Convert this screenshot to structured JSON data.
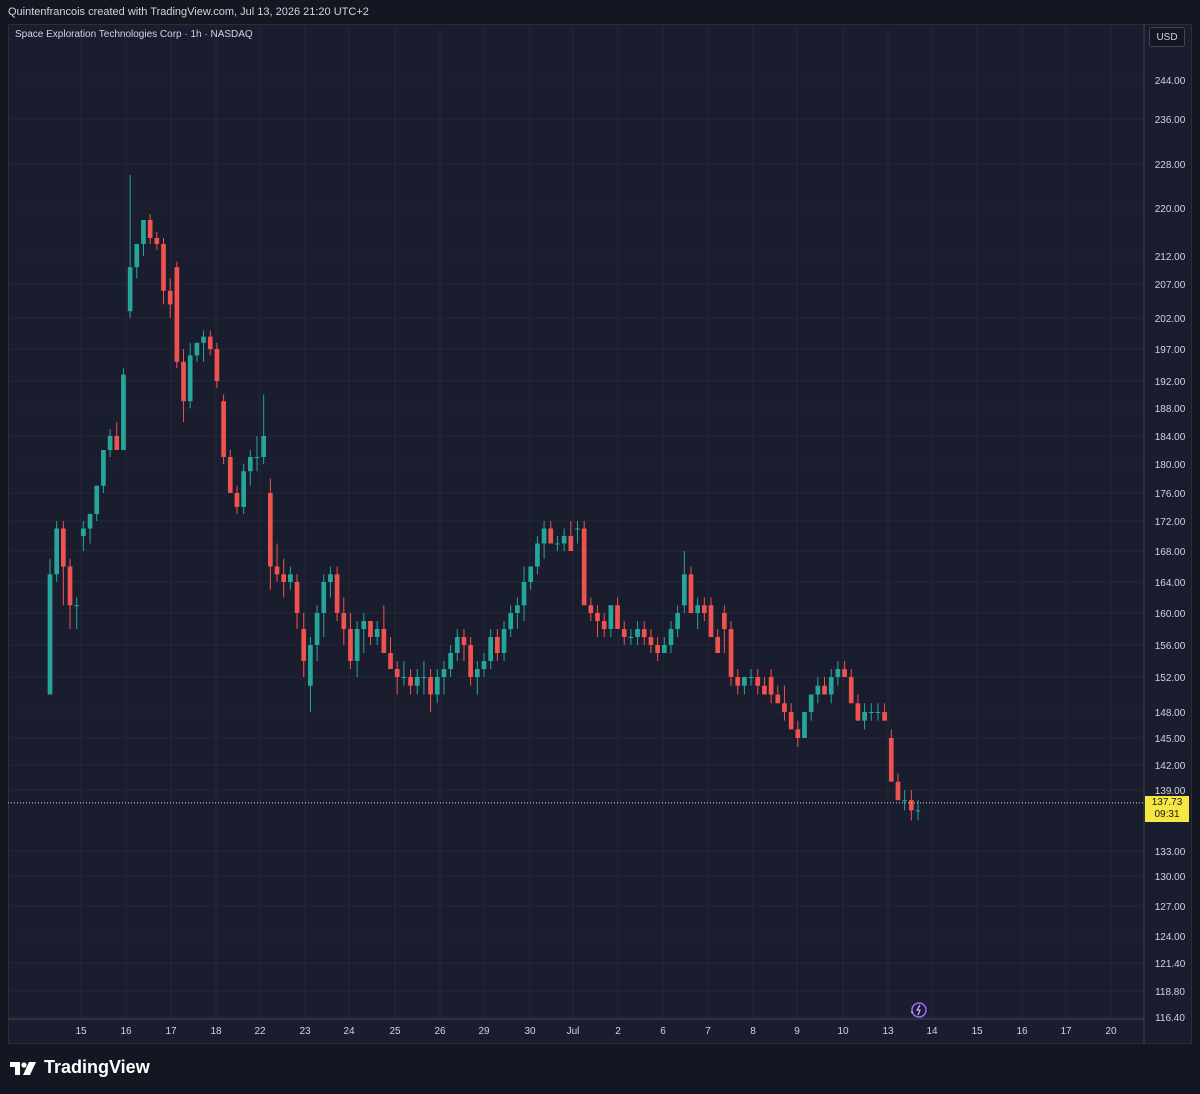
{
  "header": {
    "attribution": "Quintenfrancois created with TradingView.com, Jul 13, 2026 21:20 UTC+2"
  },
  "brand": {
    "name": "TradingView",
    "logo_icon": "tradingview-logo-icon"
  },
  "colors": {
    "up": "#26a69a",
    "down": "#ef5350",
    "background": "#1a1d2e",
    "grid": "#242838",
    "last_price_bg": "#f5e642"
  },
  "chart_data": {
    "type": "candlestick",
    "title": "Space Exploration Technologies Corp · 1h · NASDAQ",
    "currency": "USD",
    "last_price": "137.73",
    "countdown": "09:31",
    "y_ticks": [
      "244.00",
      "236.00",
      "228.00",
      "220.00",
      "212.00",
      "207.00",
      "202.00",
      "197.00",
      "192.00",
      "188.00",
      "184.00",
      "180.00",
      "176.00",
      "172.00",
      "168.00",
      "164.00",
      "160.00",
      "156.00",
      "152.00",
      "148.00",
      "145.00",
      "142.00",
      "139.00",
      "133.00",
      "130.00",
      "127.00",
      "124.00",
      "121.40",
      "118.80",
      "116.40"
    ],
    "x_ticks": [
      "15",
      "16",
      "17",
      "18",
      "22",
      "23",
      "24",
      "25",
      "26",
      "29",
      "30",
      "Jul",
      "2",
      "6",
      "7",
      "8",
      "9",
      "10",
      "13",
      "14",
      "15",
      "16",
      "17",
      "20"
    ],
    "candles": [
      [
        150,
        167,
        150,
        165
      ],
      [
        165,
        172,
        164,
        171
      ],
      [
        171,
        172,
        161,
        166
      ],
      [
        166,
        167,
        158,
        161
      ],
      [
        161,
        162,
        158,
        161
      ],
      [
        170,
        172,
        168,
        171
      ],
      [
        171,
        173,
        169,
        173
      ],
      [
        173,
        177,
        172,
        177
      ],
      [
        177,
        182,
        176,
        182
      ],
      [
        182,
        185,
        181,
        184
      ],
      [
        184,
        186,
        182,
        182
      ],
      [
        182,
        194,
        182,
        193
      ],
      [
        203,
        226,
        202,
        210
      ],
      [
        210,
        214,
        208,
        214
      ],
      [
        214,
        218,
        212,
        218
      ],
      [
        218,
        219,
        214,
        215
      ],
      [
        215,
        216,
        213,
        214
      ],
      [
        214,
        215,
        204,
        206
      ],
      [
        206,
        208,
        202,
        204
      ],
      [
        210,
        211,
        194,
        195
      ],
      [
        195,
        197,
        186,
        189
      ],
      [
        189,
        198,
        188,
        196
      ],
      [
        196,
        198,
        195,
        198
      ],
      [
        198,
        200,
        195,
        199
      ],
      [
        199,
        200,
        196,
        197
      ],
      [
        197,
        198,
        191,
        192
      ],
      [
        189,
        190,
        180,
        181
      ],
      [
        181,
        182,
        176,
        176
      ],
      [
        176,
        177,
        173,
        174
      ],
      [
        174,
        180,
        173,
        179
      ],
      [
        179,
        182,
        177,
        181
      ],
      [
        181,
        184,
        179,
        181
      ],
      [
        181,
        190,
        180,
        184
      ],
      [
        176,
        178,
        163,
        166
      ],
      [
        166,
        169,
        164,
        165
      ],
      [
        165,
        167,
        162,
        164
      ],
      [
        164,
        166,
        163,
        165
      ],
      [
        164,
        165,
        158,
        160
      ],
      [
        158,
        160,
        152,
        154
      ],
      [
        151,
        157,
        148,
        156
      ],
      [
        156,
        161,
        154,
        160
      ],
      [
        160,
        165,
        157,
        164
      ],
      [
        164,
        166,
        162,
        165
      ],
      [
        165,
        166,
        159,
        160
      ],
      [
        160,
        162,
        156,
        158
      ],
      [
        158,
        160,
        153,
        154
      ],
      [
        154,
        159,
        152,
        158
      ],
      [
        158,
        160,
        155,
        159
      ],
      [
        159,
        159,
        156,
        157
      ],
      [
        157,
        159,
        156,
        158
      ],
      [
        158,
        161,
        155,
        155
      ],
      [
        155,
        157,
        153,
        153
      ],
      [
        153,
        154,
        150,
        152
      ],
      [
        152,
        154,
        151,
        152
      ],
      [
        152,
        153,
        150,
        151
      ],
      [
        151,
        153,
        150,
        152
      ],
      [
        152,
        154,
        150,
        152
      ],
      [
        152,
        153,
        148,
        150
      ],
      [
        150,
        153,
        149,
        152
      ],
      [
        152,
        154,
        150,
        153
      ],
      [
        153,
        156,
        152,
        155
      ],
      [
        155,
        158,
        154,
        157
      ],
      [
        157,
        158,
        154,
        156
      ],
      [
        156,
        157,
        151,
        152
      ],
      [
        152,
        154,
        150,
        153
      ],
      [
        153,
        155,
        152,
        154
      ],
      [
        154,
        158,
        153,
        157
      ],
      [
        157,
        158,
        154,
        155
      ],
      [
        155,
        159,
        154,
        158
      ],
      [
        158,
        161,
        157,
        160
      ],
      [
        160,
        162,
        158,
        161
      ],
      [
        161,
        166,
        159,
        164
      ],
      [
        164,
        166,
        163,
        166
      ],
      [
        166,
        170,
        165,
        169
      ],
      [
        169,
        172,
        167,
        171
      ],
      [
        171,
        172,
        169,
        169
      ],
      [
        169,
        170,
        168,
        169
      ],
      [
        169,
        171,
        168,
        170
      ],
      [
        170,
        172,
        168,
        168
      ],
      [
        171,
        172,
        169,
        171
      ],
      [
        171,
        172,
        164,
        161
      ],
      [
        161,
        162,
        159,
        160
      ],
      [
        160,
        161,
        157,
        159
      ],
      [
        159,
        160,
        157,
        158
      ],
      [
        158,
        161,
        157,
        161
      ],
      [
        161,
        162,
        158,
        158
      ],
      [
        158,
        159,
        156,
        157
      ],
      [
        157,
        158,
        156,
        157
      ],
      [
        157,
        159,
        156,
        158
      ],
      [
        158,
        159,
        156,
        157
      ],
      [
        157,
        158,
        155,
        156
      ],
      [
        156,
        157,
        154,
        155
      ],
      [
        155,
        157,
        155,
        156
      ],
      [
        156,
        159,
        155,
        158
      ],
      [
        158,
        161,
        157,
        160
      ],
      [
        161,
        168,
        160,
        165
      ],
      [
        165,
        166,
        160,
        160
      ],
      [
        160,
        162,
        158,
        161
      ],
      [
        161,
        162,
        159,
        160
      ],
      [
        161,
        162,
        157,
        157
      ],
      [
        157,
        158,
        155,
        155
      ],
      [
        160,
        161,
        155,
        158
      ],
      [
        158,
        159,
        151,
        152
      ],
      [
        152,
        153,
        150,
        151
      ],
      [
        151,
        152,
        150,
        152
      ],
      [
        152,
        153,
        151,
        152
      ],
      [
        152,
        153,
        150,
        151
      ],
      [
        151,
        152,
        150,
        150
      ],
      [
        152,
        153,
        149,
        150
      ],
      [
        150,
        151,
        149,
        149
      ],
      [
        149,
        151,
        147,
        148
      ],
      [
        148,
        149,
        146,
        146
      ],
      [
        146,
        147,
        144,
        145
      ],
      [
        145,
        148,
        145,
        148
      ],
      [
        148,
        150,
        147,
        150
      ],
      [
        150,
        152,
        149,
        151
      ],
      [
        151,
        152,
        150,
        150
      ],
      [
        150,
        153,
        149,
        152
      ],
      [
        152,
        154,
        151,
        153
      ],
      [
        153,
        154,
        152,
        152
      ],
      [
        152,
        153,
        149,
        149
      ],
      [
        149,
        150,
        147,
        147
      ],
      [
        147,
        149,
        146,
        148
      ],
      [
        148,
        149,
        147,
        148
      ],
      [
        148,
        149,
        147,
        148
      ],
      [
        148,
        149,
        147,
        147
      ],
      [
        145,
        146,
        141,
        140
      ],
      [
        140,
        141,
        138,
        138
      ],
      [
        138,
        139,
        137,
        138
      ],
      [
        138,
        139,
        136,
        137
      ],
      [
        137,
        138,
        136,
        137
      ]
    ]
  }
}
